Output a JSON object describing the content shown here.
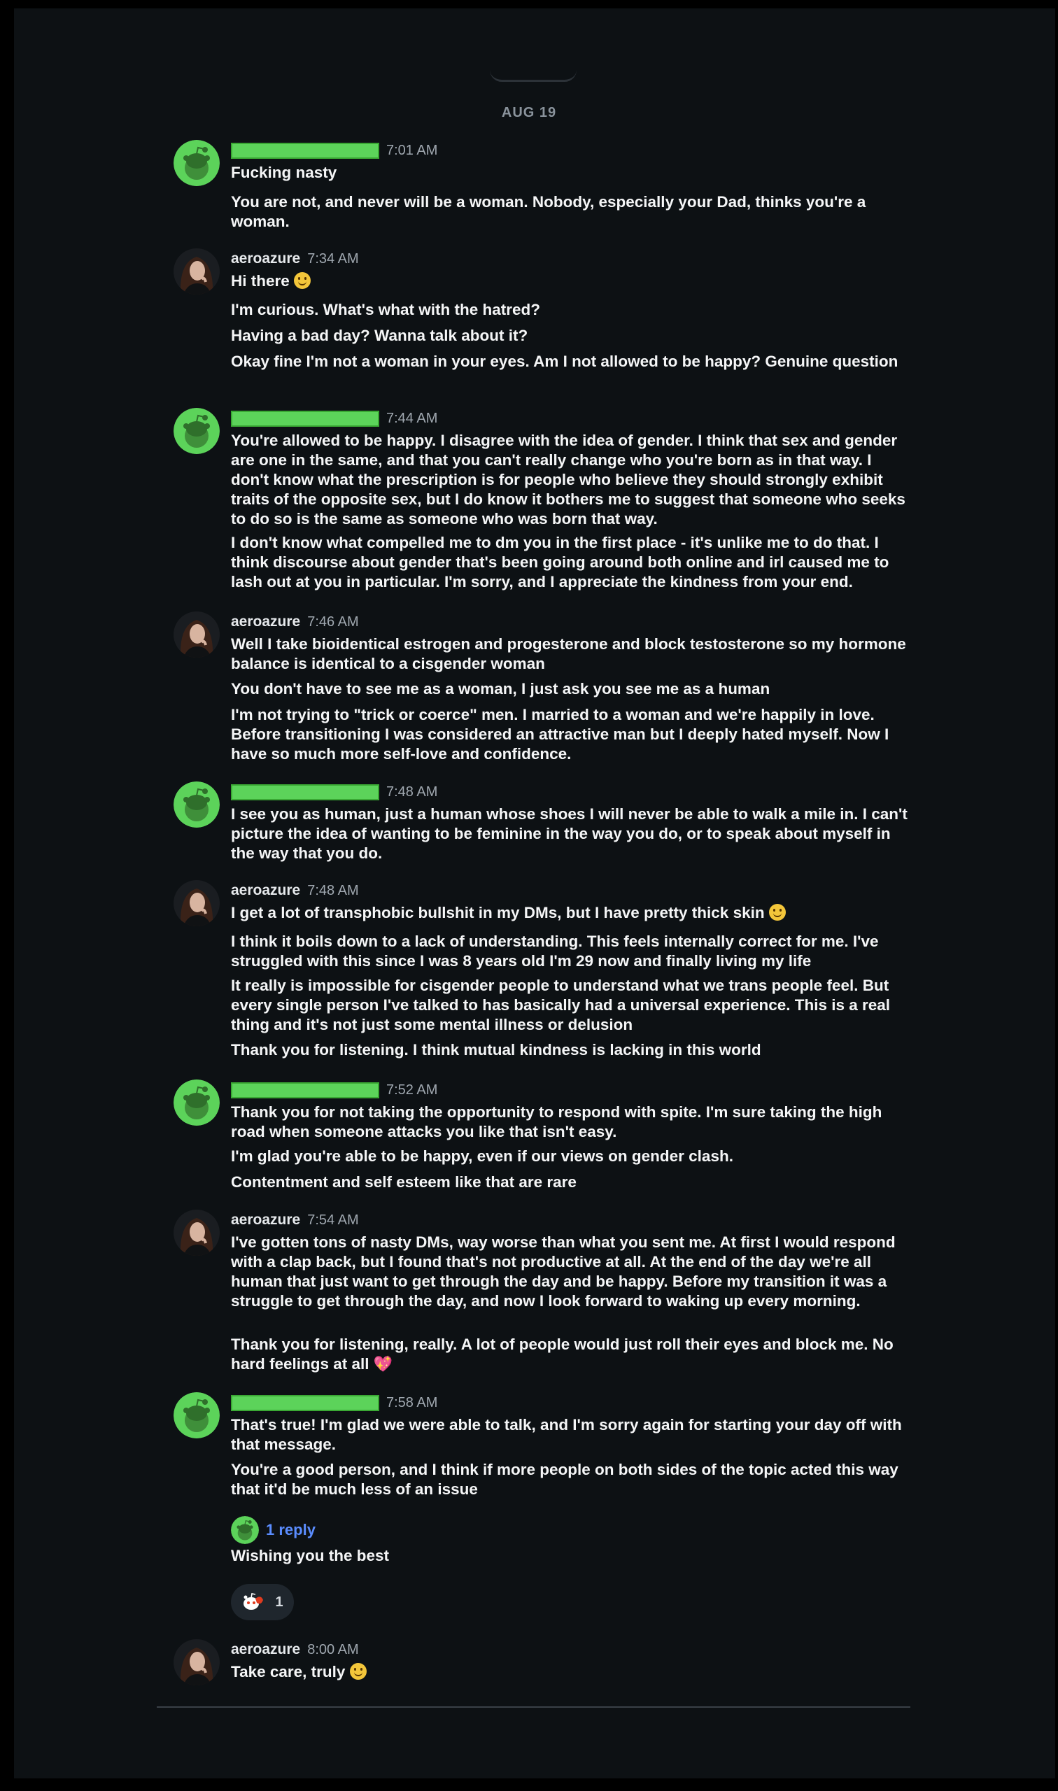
{
  "date_divider": "AUG 19",
  "colors": {
    "redaction": "#5cd35a",
    "reply_link": "#5b8dff",
    "background": "#0d1114"
  },
  "groups": [
    {
      "user": "",
      "time": "7:01 AM",
      "lines": [
        "Fucking nasty",
        "You are not, and never will be a woman. Nobody, especially your Dad, thinks you're a woman."
      ]
    },
    {
      "user": "aeroazure",
      "time": "7:34 AM",
      "lines": [
        "Hi there",
        "I'm curious. What's what with the hatred?",
        "Having a bad day? Wanna talk about it?",
        "Okay fine I'm not a woman in your eyes. Am I not allowed to be happy? Genuine question"
      ]
    },
    {
      "user": "",
      "time": "7:44 AM",
      "lines": [
        "You're allowed to be happy. I disagree with the idea of gender. I think that sex and gender are one in the same, and that you can't really change who you're born as in that way. I don't know what the prescription is for people who believe they should strongly exhibit traits of the opposite sex, but I do know it bothers me to suggest that someone who seeks to do so is the same as someone who was born that way.",
        "I don't know what compelled me to dm you in the first place - it's unlike me to do that. I think discourse about gender that's been going around both online and irl caused me to lash out at you in particular. I'm sorry, and I appreciate the kindness from your end."
      ]
    },
    {
      "user": "aeroazure",
      "time": "7:46 AM",
      "lines": [
        "Well I take bioidentical estrogen and progesterone and block testosterone so my hormone balance is identical to a cisgender woman",
        "You don't have to see me as a woman, I just ask you see me as a human",
        "I'm not trying to \"trick or coerce\" men. I married to a woman and we're happily in love. Before transitioning I was considered an attractive man but I deeply hated myself. Now I have so much more self-love and confidence."
      ]
    },
    {
      "user": "",
      "time": "7:48 AM",
      "lines": [
        "I see you as human, just a human whose shoes I will never be able to walk a mile in. I can't picture the idea of wanting to be feminine in the way you do, or to speak about myself in the way that you do."
      ]
    },
    {
      "user": "aeroazure",
      "time": "7:48 AM",
      "lines": [
        "I get a lot of transphobic bullshit in my DMs, but I have pretty thick skin",
        "I think it boils down to a lack of understanding. This feels internally correct for me. I've struggled with this since I was 8 years old I'm 29 now and finally living my life",
        "It really is impossible for cisgender people to understand what we trans people feel. But every single person I've talked to has basically had a universal experience. This is a real thing and it's not just some mental illness or delusion",
        "Thank you for listening. I think mutual kindness is lacking in this world"
      ]
    },
    {
      "user": "",
      "time": "7:52 AM",
      "lines": [
        "Thank you for not taking the opportunity to respond with spite. I'm sure taking the high road when someone attacks you like that isn't easy.",
        "I'm glad you're able to be happy, even if our views on gender clash.",
        "Contentment and self esteem like that are rare"
      ]
    },
    {
      "user": "aeroazure",
      "time": "7:54 AM",
      "lines": [
        "I've gotten tons of nasty DMs, way worse than what you sent me. At first I would respond with a clap back, but I found that's not productive at all. At the end of the day we're all human that just want to get through the day and be happy. Before my transition it was a struggle to get through the day, and now I look forward to waking up every morning.",
        "Thank you for listening, really. A lot of people would just roll their eyes and block me. No hard feelings at all"
      ]
    },
    {
      "user": "",
      "time": "7:58 AM",
      "lines": [
        "That's true! I'm glad we were able to talk, and I'm sorry again for starting your day off with that message.",
        "You're a good person, and I think if more people on both sides of the topic acted this way that it'd be much less of an issue",
        "Wishing you the best"
      ]
    },
    {
      "user": "aeroazure",
      "time": "8:00 AM",
      "lines": [
        "Take care, truly"
      ]
    }
  ],
  "reply": {
    "label": "1 reply"
  },
  "reaction": {
    "icon": "snoo-reaction-icon",
    "count": "1"
  }
}
